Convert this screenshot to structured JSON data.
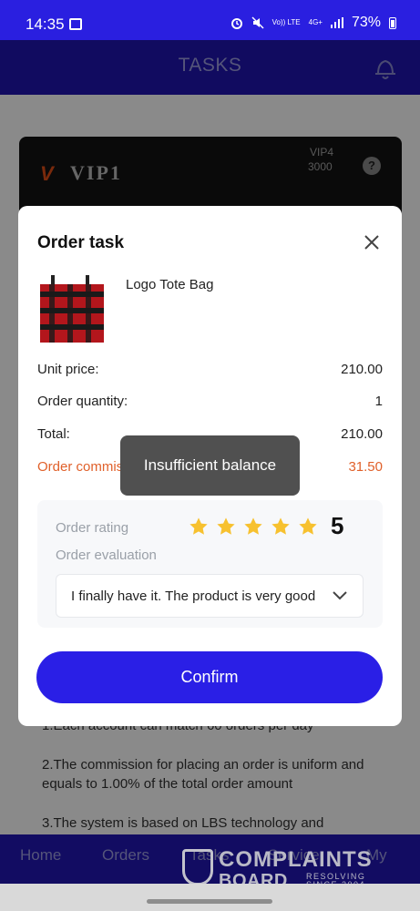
{
  "status_bar": {
    "time": "14:35",
    "volte": "Vo)) LTE",
    "network": "4G+",
    "battery": "73%"
  },
  "header": {
    "title": "TASKS"
  },
  "vip_card": {
    "logo": "V",
    "title": "VIP1",
    "level": "VIP4",
    "amount": "3000",
    "help": "?"
  },
  "modal": {
    "title": "Order task",
    "product_name": "Logo Tote Bag",
    "rows": [
      {
        "label": "Unit price:",
        "value": "210.00"
      },
      {
        "label": "Order quantity:",
        "value": "1"
      },
      {
        "label": "Total:",
        "value": "210.00"
      },
      {
        "label": "Order commission",
        "value": "31.50"
      }
    ],
    "rating_label": "Order rating",
    "rating_stars": 5,
    "rating_value": "5",
    "evaluation_label": "Order evaluation",
    "evaluation_value": "I finally have it. The product is very good",
    "confirm_label": "Confirm"
  },
  "toast": {
    "text": "Insufficient balance"
  },
  "rules": [
    "1.Each account can match 60 orders per day",
    "2.The commission for placing an order is uniform and equals to 1.00% of the total order amount",
    "3.The system is based on LBS technology and"
  ],
  "bottom_nav": {
    "items": [
      "Home",
      "Orders",
      "Tasks",
      "Service",
      "My"
    ]
  },
  "watermark": {
    "line1": "COMPLAINTS",
    "line2": "BOARD",
    "line3a": "RESOLVING",
    "line3b": "SINCE 2004"
  },
  "colors": {
    "primary": "#2a1fe6",
    "commission": "#e0602a",
    "star": "#f7c12f"
  }
}
